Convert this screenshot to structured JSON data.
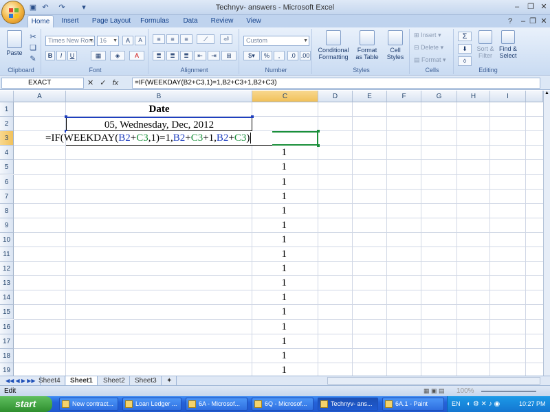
{
  "window": {
    "title": "Technyv- answers - Microsoft Excel"
  },
  "ribbon": {
    "tabs": [
      "Home",
      "Insert",
      "Page Layout",
      "Formulas",
      "Data",
      "Review",
      "View"
    ],
    "clipboard": {
      "label": "Clipboard",
      "paste": "Paste"
    },
    "font": {
      "label": "Font",
      "name": "Times New Rom",
      "size": "16"
    },
    "alignment": {
      "label": "Alignment"
    },
    "number": {
      "label": "Number",
      "format": "Custom",
      "percent": "%"
    },
    "styles": {
      "label": "Styles",
      "conditional": "Conditional",
      "conditional2": "Formatting",
      "format_table": "Format",
      "format_table2": "as Table",
      "cell_styles": "Cell",
      "cell_styles2": "Styles"
    },
    "cells": {
      "label": "Cells",
      "insert": "Insert",
      "delete": "Delete",
      "format": "Format"
    },
    "editing": {
      "label": "Editing",
      "sum": "Σ",
      "sort": "Sort &",
      "sort2": "Filter",
      "find": "Find &",
      "find2": "Select"
    }
  },
  "formula_bar": {
    "name_box": "EXACT",
    "formula": "=IF(WEEKDAY(B2+C3,1)=1,B2+C3+1,B2+C3)",
    "fx": "fx"
  },
  "columns": [
    "A",
    "B",
    "C",
    "D",
    "E",
    "F",
    "G",
    "H",
    "I"
  ],
  "rows": [
    "1",
    "2",
    "3",
    "4",
    "5",
    "6",
    "7",
    "8",
    "9",
    "10",
    "11",
    "12",
    "13",
    "14",
    "15",
    "16",
    "17",
    "18",
    "19"
  ],
  "cells": {
    "b1": "Date",
    "b2": "05, Wednesday, Dec, 2012",
    "edit": {
      "p1": "=IF(WEEKDAY(",
      "r1": "B2",
      "p2": "+",
      "r2": "C3",
      "p3": ",1)=1,",
      "r3": "B2",
      "p4": "+",
      "r4": "C3",
      "p5": "+1,",
      "r5": "B2",
      "p6": "+",
      "r6": "C3",
      "p7": ")"
    },
    "c_values": [
      "1",
      "1",
      "1",
      "1",
      "1",
      "1",
      "1",
      "1",
      "1",
      "1",
      "1",
      "1",
      "1",
      "1",
      "1",
      "1"
    ]
  },
  "sheets": [
    "Sheet4",
    "Sheet1",
    "Sheet2",
    "Sheet3"
  ],
  "active_sheet": "Sheet1",
  "status": {
    "mode": "Edit",
    "zoom": "100%"
  },
  "taskbar": {
    "start": "start",
    "tasks": [
      "New contract...",
      "Loan Ledger ...",
      "6A - Microsof...",
      "6Q - Microsof...",
      "Technyv- ans...",
      "6A.1 - Paint"
    ],
    "lang": "EN",
    "clock": "10:27 PM"
  },
  "colors": {
    "ref_blue": "#1f3fbf",
    "ref_green": "#1a8f3a",
    "accent": "#15428b"
  }
}
